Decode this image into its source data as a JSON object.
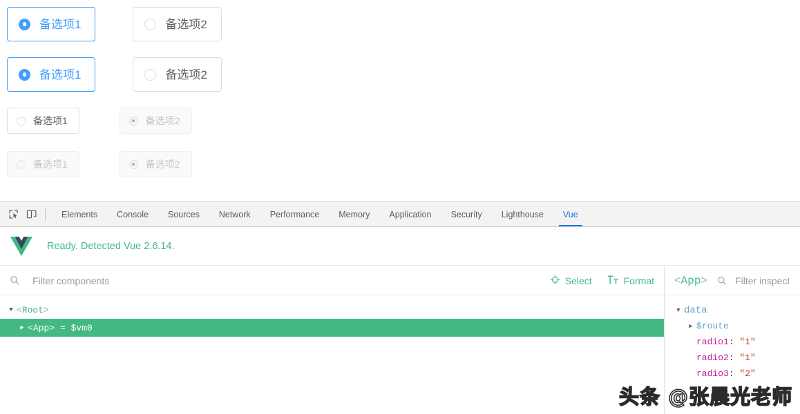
{
  "page": {
    "radio_groups": [
      {
        "size": "lg",
        "options": [
          {
            "label": "备选项1",
            "checked": true,
            "disabled": false
          },
          {
            "label": "备选项2",
            "checked": false,
            "disabled": false
          }
        ]
      },
      {
        "size": "lg",
        "options": [
          {
            "label": "备选项1",
            "checked": true,
            "disabled": false
          },
          {
            "label": "备选项2",
            "checked": false,
            "disabled": false
          }
        ]
      },
      {
        "size": "sm",
        "options": [
          {
            "label": "备选项1",
            "checked": false,
            "disabled": false
          },
          {
            "label": "备选项2",
            "checked": true,
            "disabled": true
          }
        ]
      },
      {
        "size": "sm",
        "options": [
          {
            "label": "备选项1",
            "checked": false,
            "disabled": true
          },
          {
            "label": "备选项2",
            "checked": true,
            "disabled": true
          }
        ]
      }
    ],
    "colors": {
      "accent_blue": "#409eff",
      "border_gray": "#dcdfe6",
      "disabled_text": "#c0c4cc"
    }
  },
  "devtools": {
    "toolbar_icons": [
      "inspect-element-icon",
      "device-toolbar-icon"
    ],
    "tabs": [
      {
        "label": "Elements",
        "active": false
      },
      {
        "label": "Console",
        "active": false
      },
      {
        "label": "Sources",
        "active": false
      },
      {
        "label": "Network",
        "active": false
      },
      {
        "label": "Performance",
        "active": false
      },
      {
        "label": "Memory",
        "active": false
      },
      {
        "label": "Application",
        "active": false
      },
      {
        "label": "Security",
        "active": false
      },
      {
        "label": "Lighthouse",
        "active": false
      },
      {
        "label": "Vue",
        "active": true
      }
    ],
    "active_tab_color": "#1a73e8"
  },
  "vue_panel": {
    "banner": {
      "logo": "vue-logo",
      "message": "Ready. Detected Vue 2.6.14.",
      "color": "#42b983"
    },
    "components": {
      "filter_placeholder": "Filter components",
      "filter_value": "",
      "actions": [
        {
          "label": "Select",
          "icon": "crosshair-icon"
        },
        {
          "label": "Format",
          "icon": "text-format-icon"
        }
      ],
      "tree": [
        {
          "name": "Root",
          "open": true,
          "selected": false,
          "depth": 0,
          "suffix": ""
        },
        {
          "name": "App",
          "open": false,
          "selected": true,
          "depth": 1,
          "suffix": "= $vm0"
        }
      ]
    },
    "inspector": {
      "component_tag": "App",
      "filter_placeholder": "Filter inspected data",
      "sections": [
        {
          "type": "section",
          "label": "data",
          "open": true
        },
        {
          "type": "object",
          "label": "$route",
          "open": false
        },
        {
          "type": "prop",
          "key": "radio1",
          "value": "\"1\""
        },
        {
          "type": "prop",
          "key": "radio2",
          "value": "\"1\""
        },
        {
          "type": "prop",
          "key": "radio3",
          "value": "\"2\""
        }
      ]
    }
  },
  "watermark": {
    "text": "头条 @张晨光老师"
  }
}
